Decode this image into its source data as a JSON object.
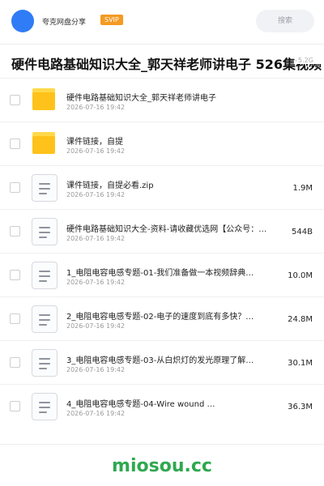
{
  "header": {
    "owner_name": "夸克网盘分享",
    "badge": "SVIP",
    "search_label": "搜索"
  },
  "folder": {
    "title": "硬件电路基础知识大全_郭天祥老师讲电子 526集视频",
    "size": "5.2G"
  },
  "files": [
    {
      "name": "硬件电路基础知识大全_郭天祥老师讲电子",
      "date": "2026-07-16 19:42",
      "size": "",
      "type": "folder"
    },
    {
      "name": "课件链接，自提",
      "date": "2026-07-16 19:42",
      "size": "",
      "type": "folder"
    },
    {
      "name": "课件链接，自提必看.zip",
      "date": "2026-07-16 19:42",
      "size": "1.9M",
      "type": "file"
    },
    {
      "name": "硬件电路基础知识大全-资料-请收藏优选网【公众号：…",
      "date": "2026-07-16 19:42",
      "size": "544B",
      "type": "file"
    },
    {
      "name": "1_电阻电容电感专题-01-我们准备做一本视频辞典…",
      "date": "2026-07-16 19:42",
      "size": "10.0M",
      "type": "file"
    },
    {
      "name": "2_电阻电容电感专题-02-电子的速度到底有多快？…",
      "date": "2026-07-16 19:42",
      "size": "24.8M",
      "type": "file"
    },
    {
      "name": "3_电阻电容电感专题-03-从白炽灯的发光原理了解…",
      "date": "2026-07-16 19:42",
      "size": "30.1M",
      "type": "file"
    },
    {
      "name": "4_电阻电容电感专题-04-Wire wound …",
      "date": "2026-07-16 19:42",
      "size": "36.3M",
      "type": "file"
    }
  ],
  "watermark": "miosou.cc"
}
